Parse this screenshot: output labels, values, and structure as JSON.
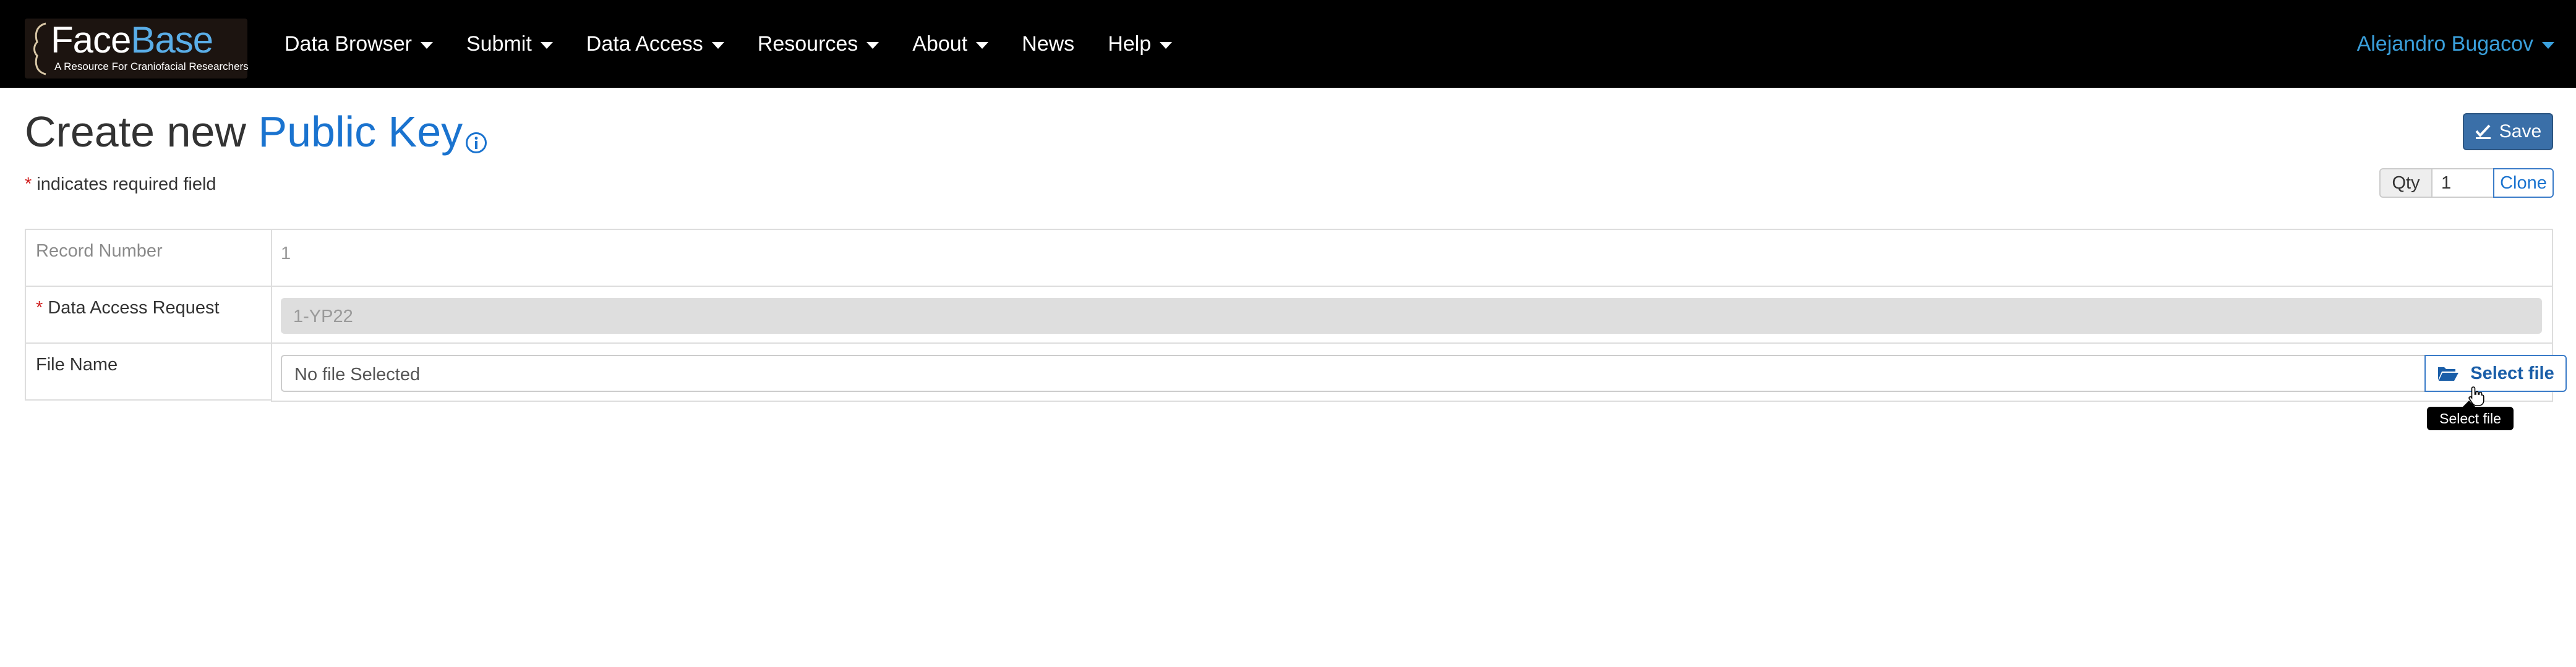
{
  "brand": {
    "name_part1": "Face",
    "name_part2": "Base",
    "tagline": "A Resource For Craniofacial Researchers"
  },
  "nav": {
    "items": [
      {
        "label": "Data Browser",
        "dropdown": true
      },
      {
        "label": "Submit",
        "dropdown": true
      },
      {
        "label": "Data Access",
        "dropdown": true
      },
      {
        "label": "Resources",
        "dropdown": true
      },
      {
        "label": "About",
        "dropdown": true
      },
      {
        "label": "News",
        "dropdown": false
      },
      {
        "label": "Help",
        "dropdown": true
      }
    ],
    "user": "Alejandro Bugacov"
  },
  "header": {
    "title_prefix": "Create new",
    "table_name": "Public Key",
    "save_label": "Save",
    "required_star": "*",
    "required_note": "indicates required field",
    "qty_label": "Qty",
    "qty_value": "1",
    "clone_label": "Clone"
  },
  "form": {
    "rows": [
      {
        "label": "Record Number",
        "value": "1",
        "required": false
      },
      {
        "label": "Data Access Request",
        "value": "1-YP22",
        "required": true
      },
      {
        "label": "File Name",
        "value": "No file Selected",
        "required": false,
        "button": "Select file"
      }
    ]
  },
  "tooltip": {
    "text": "Select file"
  },
  "colors": {
    "navbar_bg": "#000000",
    "link_blue": "#1a73cf",
    "user_blue": "#3aa0dc",
    "save_bg": "#3a6fa8",
    "required_red": "#d01f1f"
  },
  "icons": [
    "info-icon",
    "save-check-icon",
    "folder-open-icon",
    "caret-down-icon",
    "pointer-cursor-icon"
  ]
}
